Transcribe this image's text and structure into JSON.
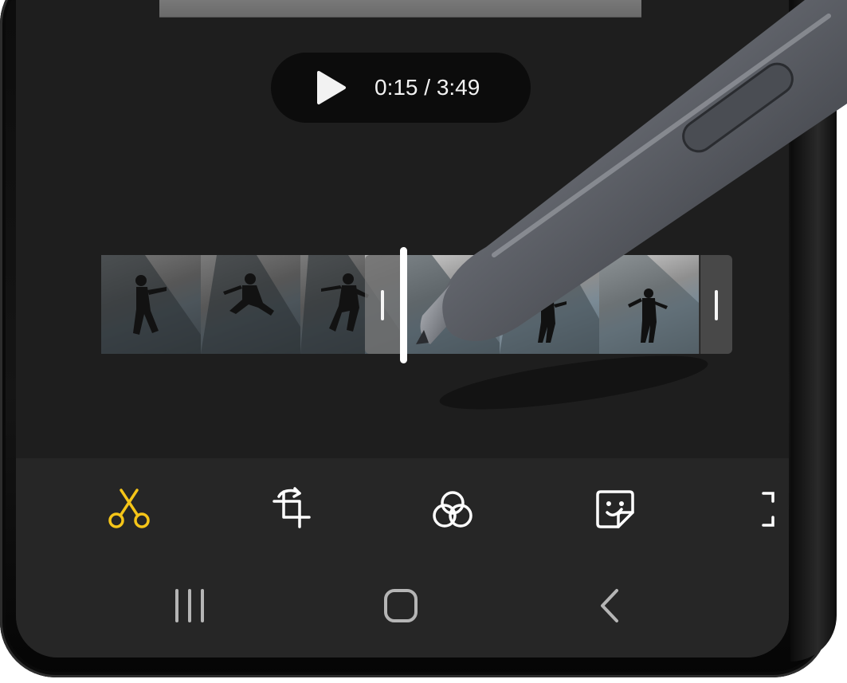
{
  "player": {
    "time_display": "0:15 / 3:49",
    "play_icon": "play-icon"
  },
  "timeline": {
    "frame_count": 6,
    "trim_start_fraction": 0.42,
    "playhead_fraction": 0.49
  },
  "toolbar": {
    "active_tool": "trim",
    "tools": [
      {
        "name": "trim",
        "icon": "scissors-icon",
        "color": "#f5c518"
      },
      {
        "name": "transform",
        "icon": "rotate-crop-icon",
        "color": "#ffffff"
      },
      {
        "name": "filters",
        "icon": "filter-circles-icon",
        "color": "#ffffff"
      },
      {
        "name": "stickers",
        "icon": "sticker-icon",
        "color": "#ffffff"
      },
      {
        "name": "more",
        "icon": "partial-icon",
        "color": "#ffffff"
      }
    ]
  },
  "nav": {
    "recents_icon": "recents-icon",
    "home_icon": "home-icon",
    "back_icon": "back-icon"
  },
  "colors": {
    "accent": "#f5c518",
    "screen_bg": "#1e1e1e",
    "toolbar_bg": "#262626"
  }
}
